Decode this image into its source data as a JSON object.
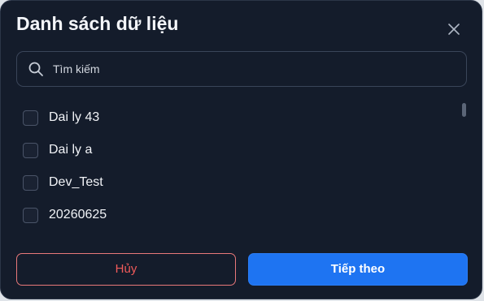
{
  "dialog": {
    "title": "Danh sách dữ liệu",
    "close_icon": "close-icon"
  },
  "search": {
    "placeholder": "Tìm kiếm",
    "value": "",
    "icon": "search-icon"
  },
  "list": {
    "items": [
      {
        "label": "Dai ly 43",
        "checked": false
      },
      {
        "label": "Dai ly a",
        "checked": false
      },
      {
        "label": "Dev_Test",
        "checked": false
      },
      {
        "label": "20260625",
        "checked": false
      }
    ]
  },
  "footer": {
    "cancel_label": "Hủy",
    "next_label": "Tiếp theo"
  },
  "colors": {
    "background": "#141c2b",
    "primary": "#1e74f2",
    "danger": "#ef5a5a"
  }
}
